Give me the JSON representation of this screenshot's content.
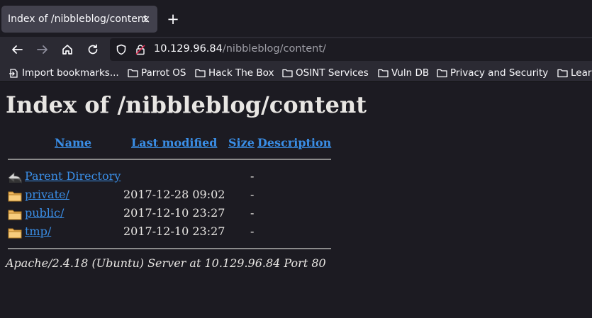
{
  "tab": {
    "title": "Index of /nibbleblog/content",
    "close": "×",
    "new_tab": "+"
  },
  "urlbar": {
    "host": "10.129.96.84",
    "path": "/nibbleblog/content/"
  },
  "bookmarks": [
    {
      "label": "Import bookmarks...",
      "icon": "import-icon"
    },
    {
      "label": "Parrot OS",
      "icon": "folder-icon"
    },
    {
      "label": "Hack The Box",
      "icon": "folder-icon"
    },
    {
      "label": "OSINT Services",
      "icon": "folder-icon"
    },
    {
      "label": "Vuln DB",
      "icon": "folder-icon"
    },
    {
      "label": "Privacy and Security",
      "icon": "folder-icon"
    },
    {
      "label": "Learn",
      "icon": "folder-icon"
    }
  ],
  "page": {
    "title": "Index of /nibbleblog/content",
    "columns": {
      "name": "Name",
      "last_modified": "Last modified",
      "size": "Size",
      "description": "Description"
    },
    "rows": [
      {
        "name": "Parent Directory",
        "date": "",
        "size": "-",
        "icon": "back-arrow-icon"
      },
      {
        "name": "private/",
        "date": "2017-12-28 09:02",
        "size": "-",
        "icon": "folder-icon"
      },
      {
        "name": "public/",
        "date": "2017-12-10 23:27",
        "size": "-",
        "icon": "folder-icon"
      },
      {
        "name": "tmp/",
        "date": "2017-12-10 23:27",
        "size": "-",
        "icon": "folder-icon"
      }
    ],
    "address": "Apache/2.4.18 (Ubuntu) Server at 10.129.96.84 Port 80"
  },
  "colors": {
    "link": "#3a8ee6",
    "text": "#e8e6e3",
    "background": "#1c1b22",
    "folder": "#f0b860"
  }
}
